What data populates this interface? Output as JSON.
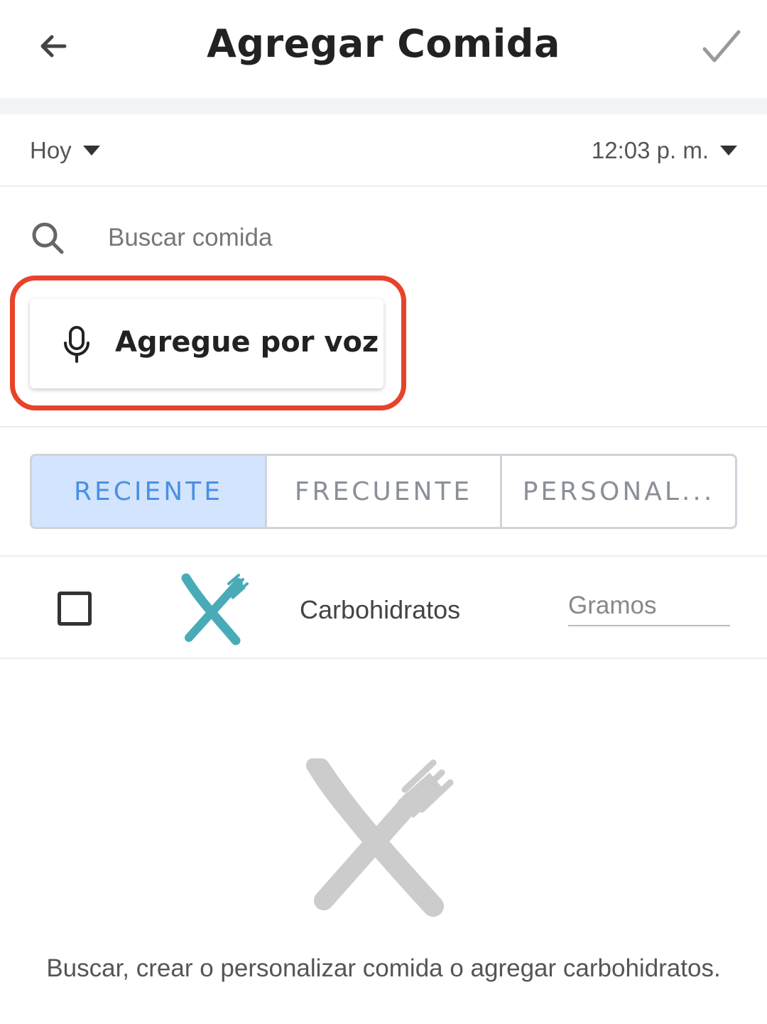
{
  "header": {
    "title": "Agregar Comida",
    "back_icon": "arrow-left-icon",
    "confirm_icon": "checkmark-icon"
  },
  "datetime": {
    "date_value": "Hoy",
    "time_value": "12:03 p. m."
  },
  "search": {
    "placeholder": "Buscar comida",
    "value": ""
  },
  "voice": {
    "label": "Agregue por voz",
    "icon": "microphone-icon"
  },
  "tabs": [
    {
      "label": "RECIENTE",
      "active": true
    },
    {
      "label": "FRECUENTE",
      "active": false
    },
    {
      "label": "PERSONAL..."
    }
  ],
  "carb_row": {
    "label": "Carbohidratos",
    "grams_placeholder": "Gramos",
    "checked": false,
    "icon": "utensils-icon"
  },
  "empty_state": {
    "message": "Buscar, crear o personalizar comida o agregar carbohidratos.",
    "icon": "utensils-icon"
  },
  "colors": {
    "accent": "#4a90e2",
    "tab_active_bg": "#d3e4ff",
    "highlight": "#e8432a",
    "teal": "#4aabb8",
    "icon_gray": "#cccccc"
  }
}
